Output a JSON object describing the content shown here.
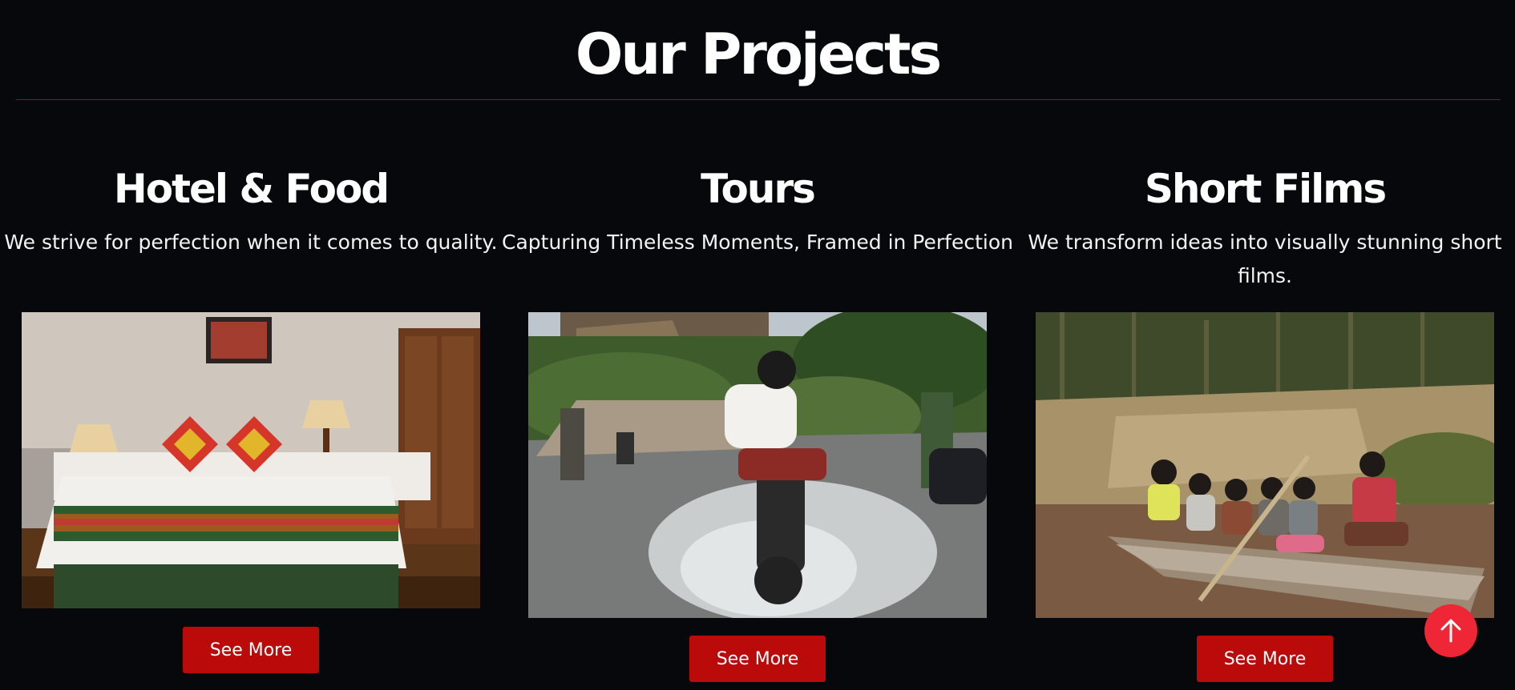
{
  "page": {
    "title": "Our Projects",
    "accent_color": "#bb0a0a",
    "rule_color": "#8f1218",
    "background_color": "#07080c"
  },
  "projects": [
    {
      "title": "Hotel & Food",
      "description": "We strive for perfection when it comes to quality.",
      "image": "hotel-bedroom-photo",
      "button_label": "See More"
    },
    {
      "title": "Tours",
      "description": "Capturing Timeless Moments, Framed in Perfection",
      "image": "motorcycle-river-crossing-photo",
      "button_label": "See More"
    },
    {
      "title": "Short Films",
      "description": "We transform ideas into visually stunning short films.",
      "image": "people-in-long-boat-photo",
      "button_label": "See More"
    }
  ],
  "scroll_top": {
    "icon": "arrow-up-icon",
    "color": "#ef2635"
  }
}
